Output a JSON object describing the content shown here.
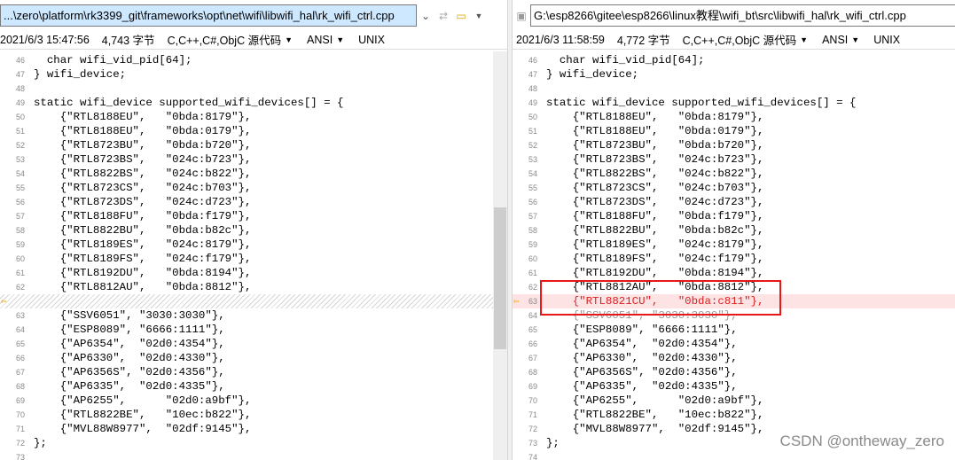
{
  "left": {
    "path": "...\\zero\\platform\\rk3399_git\\frameworks\\opt\\net\\wifi\\libwifi_hal\\rk_wifi_ctrl.cpp",
    "status": {
      "datetime": "2021/6/3 15:47:56",
      "size": "4,743 字节",
      "language": "C,C++,C#,ObjC 源代码",
      "encoding": "ANSI",
      "eol": "UNIX"
    },
    "lines": [
      {
        "n": "46",
        "code": "  char wifi_vid_pid[64];"
      },
      {
        "n": "47",
        "code": "} wifi_device;"
      },
      {
        "n": "48",
        "code": ""
      },
      {
        "n": "49",
        "code": "static wifi_device supported_wifi_devices[] = {"
      },
      {
        "n": "50",
        "code": "    {\"RTL8188EU\",   \"0bda:8179\"},"
      },
      {
        "n": "51",
        "code": "    {\"RTL8188EU\",   \"0bda:0179\"},"
      },
      {
        "n": "52",
        "code": "    {\"RTL8723BU\",   \"0bda:b720\"},"
      },
      {
        "n": "53",
        "code": "    {\"RTL8723BS\",   \"024c:b723\"},"
      },
      {
        "n": "54",
        "code": "    {\"RTL8822BS\",   \"024c:b822\"},"
      },
      {
        "n": "55",
        "code": "    {\"RTL8723CS\",   \"024c:b703\"},"
      },
      {
        "n": "56",
        "code": "    {\"RTL8723DS\",   \"024c:d723\"},"
      },
      {
        "n": "57",
        "code": "    {\"RTL8188FU\",   \"0bda:f179\"},"
      },
      {
        "n": "58",
        "code": "    {\"RTL8822BU\",   \"0bda:b82c\"},"
      },
      {
        "n": "59",
        "code": "    {\"RTL8189ES\",   \"024c:8179\"},"
      },
      {
        "n": "60",
        "code": "    {\"RTL8189FS\",   \"024c:f179\"},"
      },
      {
        "n": "61",
        "code": "    {\"RTL8192DU\",   \"0bda:8194\"},"
      },
      {
        "n": "62",
        "code": "    {\"RTL8812AU\",   \"0bda:8812\"},"
      },
      {
        "n": "",
        "code": "",
        "kind": "pad"
      },
      {
        "n": "63",
        "code": "    {\"SSV6051\", \"3030:3030\"},"
      },
      {
        "n": "64",
        "code": "    {\"ESP8089\", \"6666:1111\"},"
      },
      {
        "n": "65",
        "code": "    {\"AP6354\",  \"02d0:4354\"},"
      },
      {
        "n": "66",
        "code": "    {\"AP6330\",  \"02d0:4330\"},"
      },
      {
        "n": "67",
        "code": "    {\"AP6356S\", \"02d0:4356\"},"
      },
      {
        "n": "68",
        "code": "    {\"AP6335\",  \"02d0:4335\"},"
      },
      {
        "n": "69",
        "code": "    {\"AP6255\",      \"02d0:a9bf\"},"
      },
      {
        "n": "70",
        "code": "    {\"RTL8822BE\",   \"10ec:b822\"},"
      },
      {
        "n": "71",
        "code": "    {\"MVL88W8977\",  \"02df:9145\"},"
      },
      {
        "n": "72",
        "code": "};"
      },
      {
        "n": "73",
        "code": ""
      }
    ]
  },
  "right": {
    "path": "G:\\esp8266\\gitee\\esp8266\\linux教程\\wifi_bt\\src\\libwifi_hal\\rk_wifi_ctrl.cpp",
    "status": {
      "datetime": "2021/6/3 11:58:59",
      "size": "4,772 字节",
      "language": "C,C++,C#,ObjC 源代码",
      "encoding": "ANSI",
      "eol": "UNIX"
    },
    "lines": [
      {
        "n": "46",
        "code": "  char wifi_vid_pid[64];"
      },
      {
        "n": "47",
        "code": "} wifi_device;"
      },
      {
        "n": "48",
        "code": ""
      },
      {
        "n": "49",
        "code": "static wifi_device supported_wifi_devices[] = {"
      },
      {
        "n": "50",
        "code": "    {\"RTL8188EU\",   \"0bda:8179\"},"
      },
      {
        "n": "51",
        "code": "    {\"RTL8188EU\",   \"0bda:0179\"},"
      },
      {
        "n": "52",
        "code": "    {\"RTL8723BU\",   \"0bda:b720\"},"
      },
      {
        "n": "53",
        "code": "    {\"RTL8723BS\",   \"024c:b723\"},"
      },
      {
        "n": "54",
        "code": "    {\"RTL8822BS\",   \"024c:b822\"},"
      },
      {
        "n": "55",
        "code": "    {\"RTL8723CS\",   \"024c:b703\"},"
      },
      {
        "n": "56",
        "code": "    {\"RTL8723DS\",   \"024c:d723\"},"
      },
      {
        "n": "57",
        "code": "    {\"RTL8188FU\",   \"0bda:f179\"},"
      },
      {
        "n": "58",
        "code": "    {\"RTL8822BU\",   \"0bda:b82c\"},"
      },
      {
        "n": "59",
        "code": "    {\"RTL8189ES\",   \"024c:8179\"},"
      },
      {
        "n": "60",
        "code": "    {\"RTL8189FS\",   \"024c:f179\"},"
      },
      {
        "n": "61",
        "code": "    {\"RTL8192DU\",   \"0bda:8194\"},"
      },
      {
        "n": "62",
        "code": "    {\"RTL8812AU\",   \"0bda:8812\"},"
      },
      {
        "n": "63",
        "code": "    {\"RTL8821CU\",   \"0bda:c811\"},",
        "kind": "added"
      },
      {
        "n": "64",
        "code": "    {\"SSV6051\", \"3030:3030\"},",
        "kind": "faded"
      },
      {
        "n": "65",
        "code": "    {\"ESP8089\", \"6666:1111\"},"
      },
      {
        "n": "66",
        "code": "    {\"AP6354\",  \"02d0:4354\"},"
      },
      {
        "n": "67",
        "code": "    {\"AP6330\",  \"02d0:4330\"},"
      },
      {
        "n": "68",
        "code": "    {\"AP6356S\", \"02d0:4356\"},"
      },
      {
        "n": "69",
        "code": "    {\"AP6335\",  \"02d0:4335\"},"
      },
      {
        "n": "70",
        "code": "    {\"AP6255\",      \"02d0:a9bf\"},"
      },
      {
        "n": "71",
        "code": "    {\"RTL8822BE\",   \"10ec:b822\"},"
      },
      {
        "n": "72",
        "code": "    {\"MVL88W8977\",  \"02df:9145\"},"
      },
      {
        "n": "73",
        "code": "};"
      },
      {
        "n": "74",
        "code": ""
      }
    ]
  },
  "toolbar": {
    "dropdown_icon": "chevron-down-icon",
    "back_icon": "swap-arrows-icon",
    "open_icon": "folder-icon",
    "save_icon": "save-icon"
  },
  "diff": {
    "marker_icon": "diff-arrow-icon",
    "highlight_color": "#e81818",
    "added_color": "#e02020"
  },
  "watermark": "CSDN @ontheway_zero"
}
